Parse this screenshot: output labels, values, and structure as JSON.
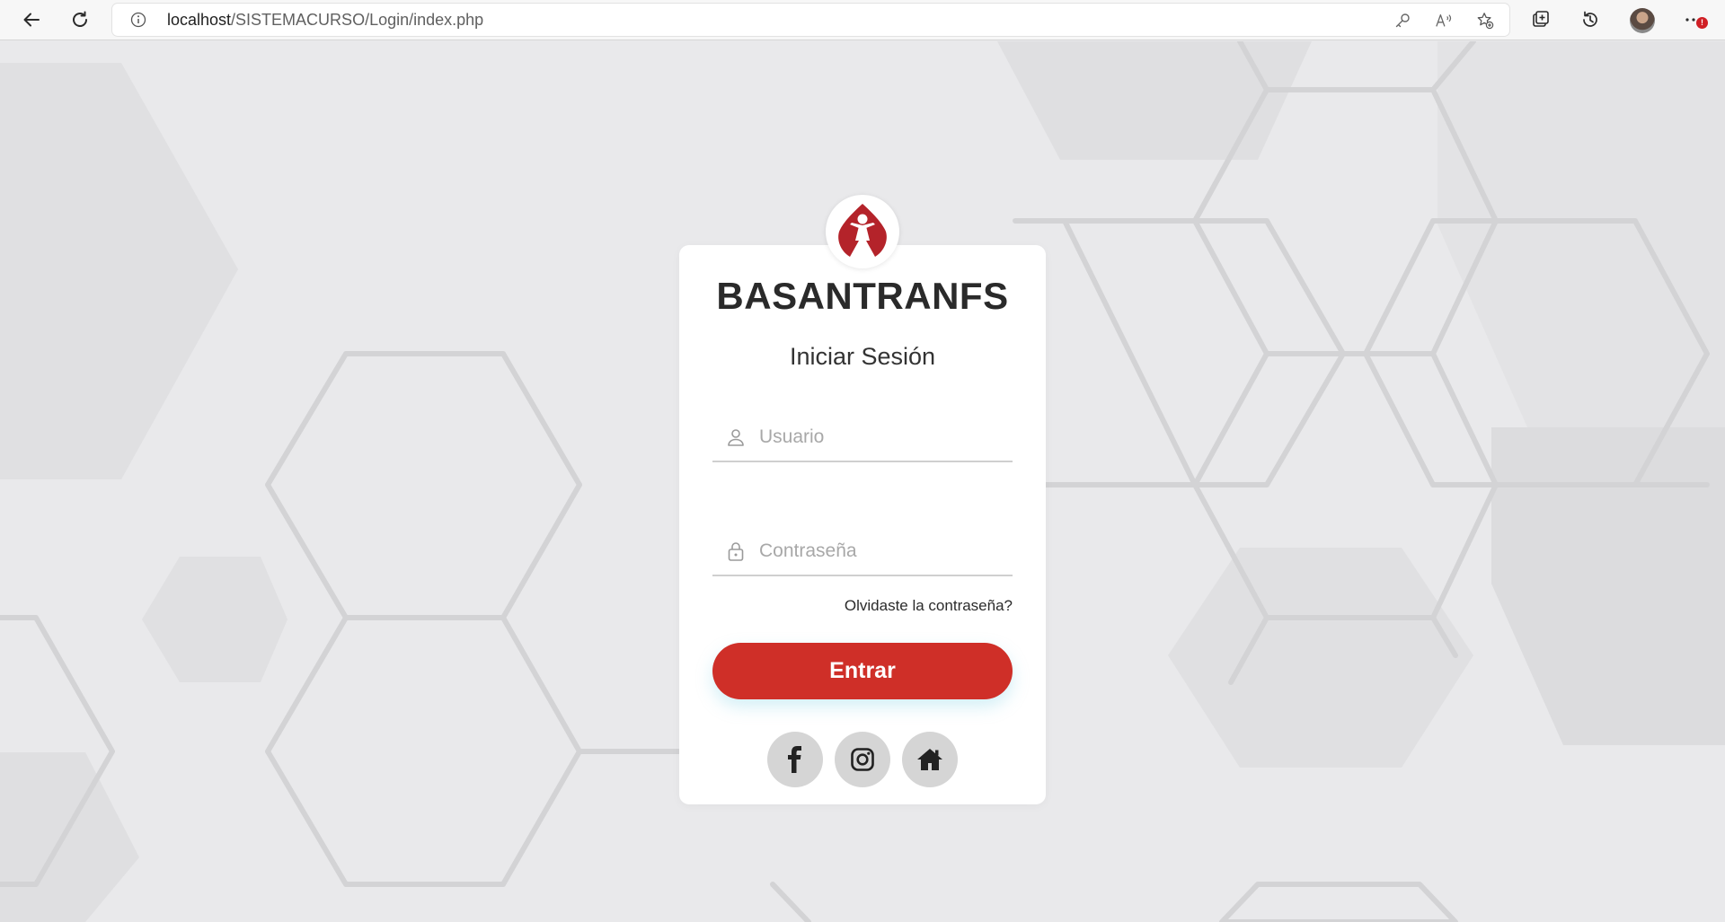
{
  "browser": {
    "url_host": "localhost",
    "url_path": "/SISTEMACURSO/Login/index.php",
    "icons": [
      "back-arrow-icon",
      "refresh-icon",
      "info-icon",
      "key-icon",
      "read-aloud-icon",
      "favorite-star-icon",
      "collections-icon",
      "history-icon",
      "profile-avatar",
      "more-menu-icon"
    ],
    "notification_badge": "!"
  },
  "login": {
    "brand": "BASANTRANFS",
    "subtitle": "Iniciar Sesión",
    "username_placeholder": "Usuario",
    "password_placeholder": "Contraseña",
    "forgot_link": "Olvidaste la contraseña?",
    "submit_label": "Entrar",
    "social_icons": [
      "facebook-icon",
      "instagram-icon",
      "home-icon"
    ]
  },
  "colors": {
    "accent_red": "#cf2f28",
    "background": "#e9e9eb",
    "card": "#ffffff",
    "social_button": "#d5d5d5"
  }
}
